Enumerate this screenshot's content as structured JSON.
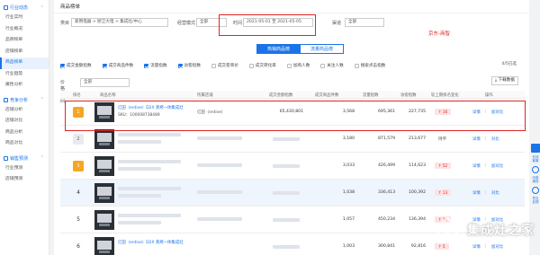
{
  "sidebar": {
    "groups": [
      {
        "label": "行业动态",
        "items": [
          "行业实时",
          "行业概况",
          "品牌榜单",
          "店铺榜单",
          "商品榜单",
          "行业趋势",
          "属性分析"
        ]
      },
      {
        "label": "竞争分析",
        "items": [
          "店铺分析",
          "店铺对比",
          "商品分析",
          "商品对比"
        ]
      },
      {
        "label": "销售预测",
        "items": [
          "行业预测",
          "店铺预测"
        ]
      }
    ],
    "active_item": "商品榜单"
  },
  "header": {
    "title": "商品榜单"
  },
  "filters": {
    "category_label": "类目",
    "category_value": "家用电器 > 厨卫大电 > 集成灶/中心",
    "mode_label": "经营模式",
    "mode_value": "全部",
    "time_label": "时间",
    "time_value": "2021-05-01 至 2021-05-05",
    "channel_label": "渠道",
    "channel_value": "全部"
  },
  "annotation": "京东-商智",
  "tabs": [
    {
      "label": "热销商品榜",
      "active": true
    },
    {
      "label": "流量商品榜",
      "active": false
    }
  ],
  "metrics": [
    {
      "label": "成交金额指数",
      "checked": true
    },
    {
      "label": "成交商品件数",
      "checked": true
    },
    {
      "label": "流量指数",
      "checked": true
    },
    {
      "label": "访客指数",
      "checked": true
    },
    {
      "label": "成交客单价",
      "checked": false
    },
    {
      "label": "成交转化率",
      "checked": false
    },
    {
      "label": "加购人数",
      "checked": false
    },
    {
      "label": "关注人数",
      "checked": false
    },
    {
      "label": "搜索点击指数",
      "checked": false
    }
  ],
  "page_indicator": "4/5已选",
  "category_select": {
    "label": "价格区间",
    "value": "全部"
  },
  "download_label": "下载数据",
  "table": {
    "headers": [
      "排名",
      "商品名称",
      "所属店铺",
      "成交金额指数",
      "成交商品件数",
      "流量指数",
      "访客指数",
      "较上期排名变化",
      "操作"
    ],
    "rows": [
      {
        "rank": "1",
        "rank_style": "badge",
        "name": "亿田（entive）D2X 蒸烤一体集成灶",
        "sku": "SKU：100008738489",
        "shop": "亿田（entive）",
        "amount": "65,430,801",
        "units": "3,568",
        "traffic": "695,361",
        "visitors": "227,735",
        "change": "↑ 16",
        "change_type": "up",
        "detail": "详情",
        "compare": "加对比",
        "hover": false
      },
      {
        "rank": "2",
        "rank_style": "plain",
        "name": "",
        "sku": "",
        "shop": "",
        "amount": "",
        "units": "3,180",
        "traffic": "871,579",
        "visitors": "213,677",
        "change": "持平",
        "change_type": "flat",
        "detail": "详情",
        "compare": "对比",
        "hover": false
      },
      {
        "rank": "3",
        "rank_style": "badge",
        "name": "",
        "sku": "",
        "shop": "",
        "amount": "",
        "units": "3,033",
        "traffic": "426,499",
        "visitors": "114,623",
        "change": "↑ 52",
        "change_type": "up",
        "detail": "详情",
        "compare": "加对比",
        "hover": false
      },
      {
        "rank": "4",
        "rank_style": "num",
        "name": "",
        "sku": "",
        "shop": "",
        "amount": "",
        "units": "1,038",
        "traffic": "336,413",
        "visitors": "100,392",
        "change": "↑ 13",
        "change_type": "up",
        "detail": "详情",
        "compare": "对比",
        "hover": true
      },
      {
        "rank": "5",
        "rank_style": "num",
        "name": "",
        "sku": "",
        "shop": "",
        "amount": "",
        "units": "1,057",
        "traffic": "450,234",
        "visitors": "136,394",
        "change": "↑ 16",
        "change_type": "up",
        "detail": "详情",
        "compare": "加对比",
        "hover": false
      },
      {
        "rank": "6",
        "rank_style": "num",
        "name": "亿田（entive）D2X 蒸烤一体集成灶",
        "sku": "",
        "shop": "",
        "amount": "",
        "units": "1,003",
        "traffic": "300,841",
        "visitors": "92,816",
        "change": "↑ 5",
        "change_type": "up",
        "detail": "详情",
        "compare": "加对比",
        "hover": false
      }
    ]
  },
  "rail": {
    "items": [
      "在线客服",
      "问卷调查",
      "意见反馈"
    ]
  },
  "watermark": {
    "text": "集成灶之家"
  },
  "colors": {
    "accent": "#1a73e8",
    "highlight": "#e02424",
    "badge": "#f5a623",
    "up_bg": "#fde2e2"
  }
}
